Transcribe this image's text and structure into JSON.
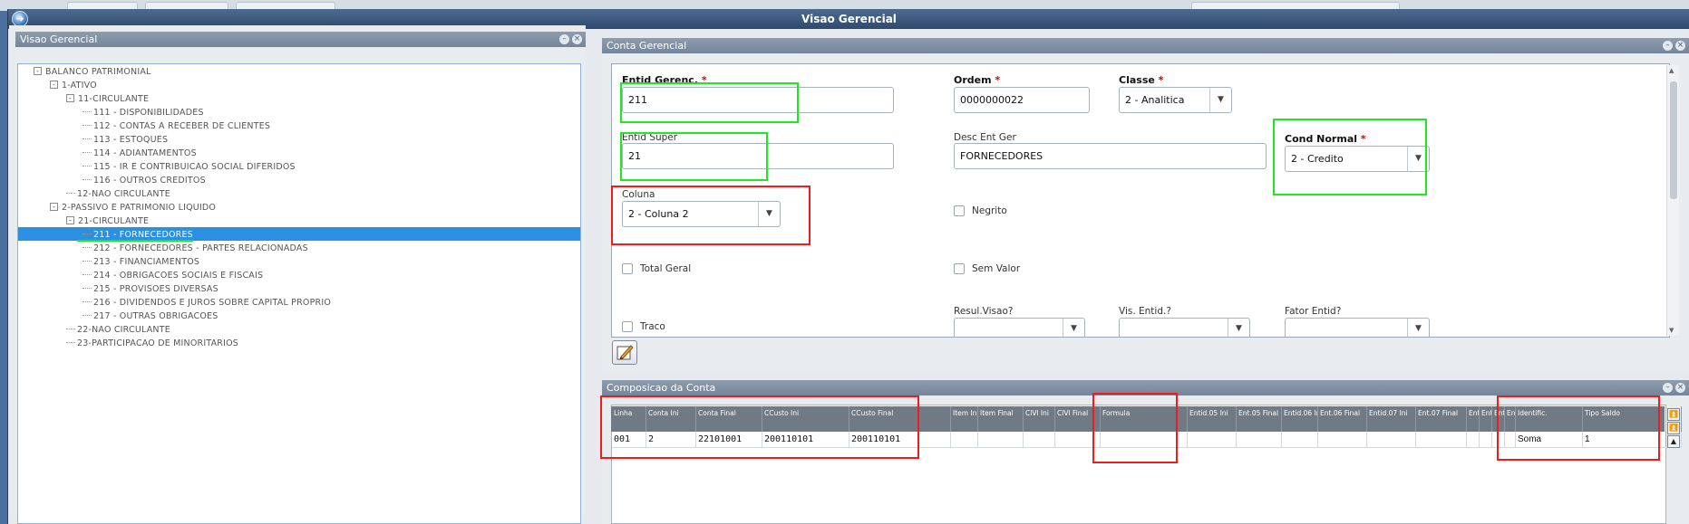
{
  "window": {
    "title": "Visao Gerencial"
  },
  "tree_panel": {
    "title": "Visao Gerencial",
    "nodes": [
      {
        "label": "BALANCO PATRIMONIAL",
        "expander": "-"
      },
      {
        "label": "1-ATIVO",
        "expander": "-"
      },
      {
        "label": "11-CIRCULANTE",
        "expander": "-"
      },
      {
        "label": "111 - DISPONIBILIDADES"
      },
      {
        "label": "112 - CONTAS A RECEBER DE CLIENTES"
      },
      {
        "label": "113 - ESTOQUES"
      },
      {
        "label": "114 - ADIANTAMENTOS"
      },
      {
        "label": "115 - IR E CONTRIBUICAO SOCIAL DIFERIDOS"
      },
      {
        "label": "116 - OUTROS CREDITOS"
      },
      {
        "label": "12-NAO CIRCULANTE"
      },
      {
        "label": "2-PASSIVO E PATRIMONIO LIQUIDO",
        "expander": "-"
      },
      {
        "label": "21-CIRCULANTE",
        "expander": "-"
      },
      {
        "label": "211 - FORNECEDORES",
        "selected": true
      },
      {
        "label": "212 - FORNECEDORES - PARTES RELACIONADAS"
      },
      {
        "label": "213 - FINANCIAMENTOS"
      },
      {
        "label": "214 - OBRIGACOES SOCIAIS E FISCAIS"
      },
      {
        "label": "215 - PROVISOES DIVERSAS"
      },
      {
        "label": "216 - DIVIDENDOS E JUROS SOBRE CAPITAL PROPRIO"
      },
      {
        "label": "217 - OUTRAS OBRIGACOES"
      },
      {
        "label": "22-NAO CIRCULANTE"
      },
      {
        "label": "23-PARTICIPACAO DE MINORITARIOS"
      }
    ]
  },
  "form_panel": {
    "title": "Conta Gerencial",
    "entid_gerenc": {
      "label": "Entid Gerenc.",
      "required": "*",
      "value": "211"
    },
    "ordem": {
      "label": "Ordem",
      "required": "*",
      "value": "0000000022"
    },
    "classe": {
      "label": "Classe",
      "required": "*",
      "value": "2 - Analitica"
    },
    "entid_super": {
      "label": "Entid Super",
      "value": "21"
    },
    "desc_ent_ger": {
      "label": "Desc Ent Ger",
      "value": "FORNECEDORES"
    },
    "cond_normal": {
      "label": "Cond Normal",
      "required": "*",
      "value": "2 - Credito"
    },
    "coluna": {
      "label": "Coluna",
      "value": "2 - Coluna 2"
    },
    "negrito": {
      "label": "Negrito"
    },
    "total_geral": {
      "label": "Total Geral"
    },
    "sem_valor": {
      "label": "Sem Valor"
    },
    "traco": {
      "label": "Traco"
    },
    "resul_visao": {
      "label": "Resul.Visao?",
      "value": ""
    },
    "vis_entid": {
      "label": "Vis. Entid.?",
      "value": ""
    },
    "fator_entid": {
      "label": "Fator Entid?",
      "value": ""
    },
    "edit_button_icon": "edit-icon"
  },
  "grid_panel": {
    "title": "Composicao da Conta",
    "columns": [
      "Linha",
      "Conta Ini",
      "Conta Final",
      "CCusto Ini",
      "CCusto Final",
      "Item Ini",
      "Item Final",
      "ClVl Ini",
      "ClVl Final",
      "Formula",
      "Entid.05 Ini",
      "Ent.05 Final",
      "Entid.06 Ini",
      "Ent.06 Final",
      "Entid.07 Ini",
      "Ent.07 Final",
      "Enti",
      "Ent",
      "Enti",
      "Ent",
      "Identific.",
      "Tipo Saldo"
    ],
    "rows": [
      [
        "001",
        "2",
        "22101001",
        "200110101",
        "200110101",
        "",
        "",
        "",
        "",
        "",
        "",
        "",
        "",
        "",
        "",
        "",
        "",
        "",
        "",
        "",
        "Soma",
        "1"
      ]
    ]
  },
  "colors": {
    "titlebar": "#3b5679",
    "selection": "#2b8fe2",
    "highlight_green": "#1ee81e",
    "highlight_red": "#ee1c1c"
  }
}
